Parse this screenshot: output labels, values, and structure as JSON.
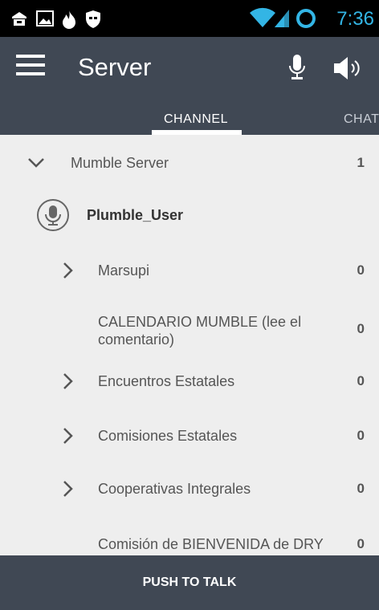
{
  "status_bar": {
    "time": "7:36",
    "icons": [
      "lock-screen-icon",
      "image-icon",
      "fire-icon",
      "shield-icon",
      "wifi-icon",
      "signal-icon",
      "sync-icon"
    ]
  },
  "action_bar": {
    "title": "Server",
    "icons": [
      "menu-icon",
      "microphone-icon",
      "speaker-icon"
    ]
  },
  "tabs": [
    {
      "label": "CHANNEL",
      "selected": true
    },
    {
      "label": "CHAT",
      "selected": false
    }
  ],
  "channels": {
    "server": {
      "name": "Mumble Server",
      "count": "1"
    },
    "user": {
      "name": "Plumble_User"
    },
    "items": [
      {
        "name": "Marsupi",
        "count": "0",
        "expandable": true
      },
      {
        "name": "CALENDARIO MUMBLE (lee el comentario)",
        "count": "0",
        "expandable": false
      },
      {
        "name": "Encuentros Estatales",
        "count": "0",
        "expandable": true
      },
      {
        "name": "Comisiones Estatales",
        "count": "0",
        "expandable": true
      },
      {
        "name": "Cooperativas Integrales",
        "count": "0",
        "expandable": true
      },
      {
        "name": "Comisión de BIENVENIDA de DRY",
        "count": "0",
        "expandable": false
      }
    ]
  },
  "push_to_talk": {
    "label": "PUSH TO TALK"
  },
  "colors": {
    "accent": "#33b5e5",
    "toolbar": "#404854",
    "list_bg": "#eeeeee",
    "text": "#555555"
  }
}
